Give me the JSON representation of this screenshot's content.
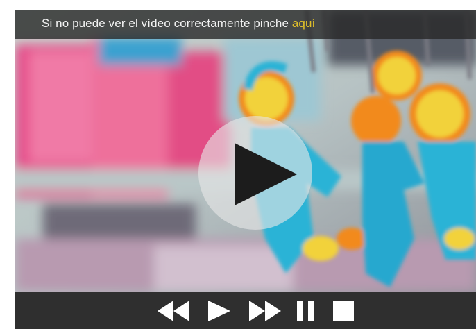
{
  "notice": {
    "text": "Si no puede ver el vídeo correctamente pinche ",
    "link_label": "aquí"
  },
  "video": {
    "big_play_icon": "play-icon"
  },
  "controls": {
    "buttons": [
      {
        "name": "rewind",
        "icon": "rewind-icon"
      },
      {
        "name": "play",
        "icon": "play-icon"
      },
      {
        "name": "fast-forward",
        "icon": "fast-forward-icon"
      },
      {
        "name": "pause",
        "icon": "pause-icon"
      },
      {
        "name": "stop",
        "icon": "stop-icon"
      }
    ]
  },
  "colors": {
    "link": "#e0c02a",
    "control_bar": "#2f2f2f",
    "keychain_blue": "#2bb3d6",
    "keychain_yellow": "#f2d23a",
    "keychain_orange": "#f28a1e"
  }
}
